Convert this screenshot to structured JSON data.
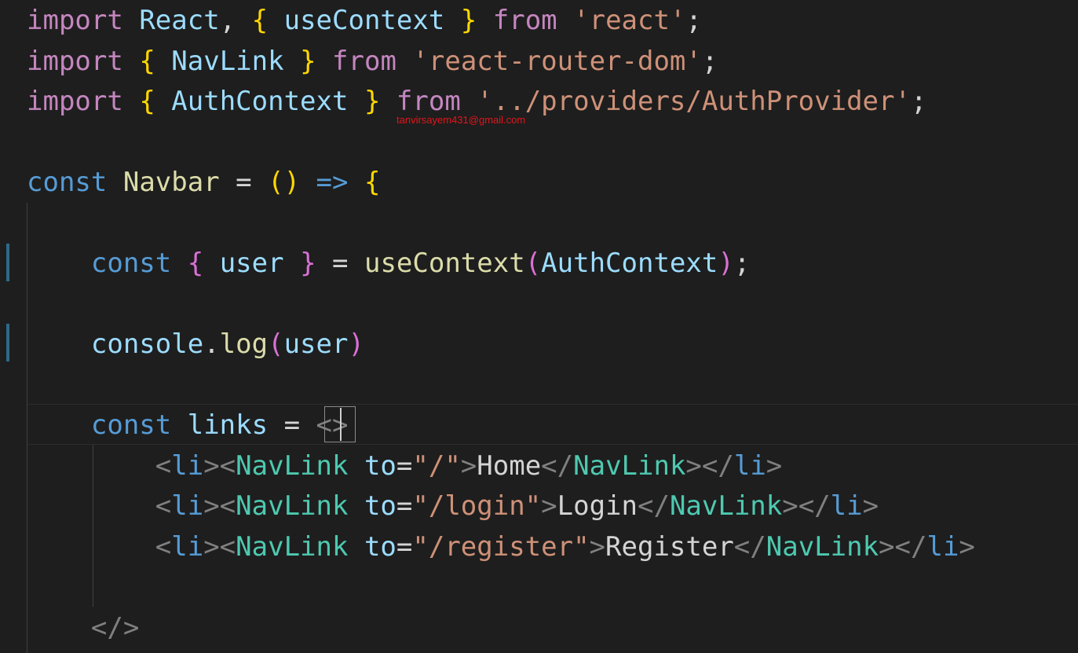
{
  "editor": {
    "language": "javascript-react",
    "theme": "dark",
    "colors": {
      "background": "#1e1e1e",
      "keyword_import": "#c586c0",
      "keyword_const": "#569cd6",
      "variable": "#9cdcfe",
      "function": "#dcdcaa",
      "string": "#ce9178",
      "bracket_level1": "#ffd700",
      "bracket_level2": "#da70d6",
      "bracket_level3": "#179fff",
      "component": "#4ec9b0",
      "angle_bracket": "#808080"
    }
  },
  "watermark": "tanvirsayem431@gmail.com",
  "lines": [
    [
      {
        "t": "import",
        "c": "t-kw"
      },
      {
        "t": " ",
        "c": "t-txt"
      },
      {
        "t": "React",
        "c": "t-var"
      },
      {
        "t": ", ",
        "c": "t-txt"
      },
      {
        "t": "{",
        "c": "t-br1"
      },
      {
        "t": " ",
        "c": "t-txt"
      },
      {
        "t": "useContext",
        "c": "t-var"
      },
      {
        "t": " ",
        "c": "t-txt"
      },
      {
        "t": "}",
        "c": "t-br1"
      },
      {
        "t": " ",
        "c": "t-txt"
      },
      {
        "t": "from",
        "c": "t-kw"
      },
      {
        "t": " ",
        "c": "t-txt"
      },
      {
        "t": "'react'",
        "c": "t-str"
      },
      {
        "t": ";",
        "c": "t-txt"
      }
    ],
    [
      {
        "t": "import",
        "c": "t-kw"
      },
      {
        "t": " ",
        "c": "t-txt"
      },
      {
        "t": "{",
        "c": "t-br1"
      },
      {
        "t": " ",
        "c": "t-txt"
      },
      {
        "t": "NavLink",
        "c": "t-var"
      },
      {
        "t": " ",
        "c": "t-txt"
      },
      {
        "t": "}",
        "c": "t-br1"
      },
      {
        "t": " ",
        "c": "t-txt"
      },
      {
        "t": "from",
        "c": "t-kw"
      },
      {
        "t": " ",
        "c": "t-txt"
      },
      {
        "t": "'react-router-dom'",
        "c": "t-str"
      },
      {
        "t": ";",
        "c": "t-txt"
      }
    ],
    [
      {
        "t": "import",
        "c": "t-kw"
      },
      {
        "t": " ",
        "c": "t-txt"
      },
      {
        "t": "{",
        "c": "t-br1"
      },
      {
        "t": " ",
        "c": "t-txt"
      },
      {
        "t": "AuthContext",
        "c": "t-var"
      },
      {
        "t": " ",
        "c": "t-txt"
      },
      {
        "t": "}",
        "c": "t-br1"
      },
      {
        "t": " ",
        "c": "t-txt"
      },
      {
        "t": "from",
        "c": "t-kw"
      },
      {
        "t": " ",
        "c": "t-txt"
      },
      {
        "t": "'../providers/AuthProvider'",
        "c": "t-str"
      },
      {
        "t": ";",
        "c": "t-txt"
      }
    ],
    [],
    [
      {
        "t": "const",
        "c": "t-kw2"
      },
      {
        "t": " ",
        "c": "t-txt"
      },
      {
        "t": "Navbar",
        "c": "t-fn"
      },
      {
        "t": " = ",
        "c": "t-txt"
      },
      {
        "t": "()",
        "c": "t-br1"
      },
      {
        "t": " ",
        "c": "t-txt"
      },
      {
        "t": "=>",
        "c": "t-kw2"
      },
      {
        "t": " ",
        "c": "t-txt"
      },
      {
        "t": "{",
        "c": "t-br1"
      }
    ],
    [],
    [
      {
        "t": "    ",
        "c": "t-txt"
      },
      {
        "t": "const",
        "c": "t-kw2"
      },
      {
        "t": " ",
        "c": "t-txt"
      },
      {
        "t": "{",
        "c": "t-br2"
      },
      {
        "t": " ",
        "c": "t-txt"
      },
      {
        "t": "user",
        "c": "t-var"
      },
      {
        "t": " ",
        "c": "t-txt"
      },
      {
        "t": "}",
        "c": "t-br2"
      },
      {
        "t": " = ",
        "c": "t-txt"
      },
      {
        "t": "useContext",
        "c": "t-fn"
      },
      {
        "t": "(",
        "c": "t-br2"
      },
      {
        "t": "AuthContext",
        "c": "t-var"
      },
      {
        "t": ")",
        "c": "t-br2"
      },
      {
        "t": ";",
        "c": "t-txt"
      }
    ],
    [],
    [
      {
        "t": "    ",
        "c": "t-txt"
      },
      {
        "t": "console",
        "c": "t-var"
      },
      {
        "t": ".",
        "c": "t-txt"
      },
      {
        "t": "log",
        "c": "t-fn"
      },
      {
        "t": "(",
        "c": "t-br2"
      },
      {
        "t": "user",
        "c": "t-var"
      },
      {
        "t": ")",
        "c": "t-br2"
      }
    ],
    [],
    [
      {
        "t": "    ",
        "c": "t-txt"
      },
      {
        "t": "const",
        "c": "t-kw2"
      },
      {
        "t": " ",
        "c": "t-txt"
      },
      {
        "t": "links",
        "c": "t-var"
      },
      {
        "t": " = ",
        "c": "t-txt"
      },
      {
        "t": "<>",
        "c": "t-ang"
      }
    ],
    [
      {
        "t": "        ",
        "c": "t-txt"
      },
      {
        "t": "<",
        "c": "t-ang"
      },
      {
        "t": "li",
        "c": "t-tag"
      },
      {
        "t": "><",
        "c": "t-ang"
      },
      {
        "t": "NavLink",
        "c": "t-comp"
      },
      {
        "t": " ",
        "c": "t-txt"
      },
      {
        "t": "to",
        "c": "t-attr"
      },
      {
        "t": "=",
        "c": "t-txt"
      },
      {
        "t": "\"/\"",
        "c": "t-str"
      },
      {
        "t": ">",
        "c": "t-ang"
      },
      {
        "t": "Home",
        "c": "t-txt"
      },
      {
        "t": "</",
        "c": "t-ang"
      },
      {
        "t": "NavLink",
        "c": "t-comp"
      },
      {
        "t": "></",
        "c": "t-ang"
      },
      {
        "t": "li",
        "c": "t-tag"
      },
      {
        "t": ">",
        "c": "t-ang"
      }
    ],
    [
      {
        "t": "        ",
        "c": "t-txt"
      },
      {
        "t": "<",
        "c": "t-ang"
      },
      {
        "t": "li",
        "c": "t-tag"
      },
      {
        "t": "><",
        "c": "t-ang"
      },
      {
        "t": "NavLink",
        "c": "t-comp"
      },
      {
        "t": " ",
        "c": "t-txt"
      },
      {
        "t": "to",
        "c": "t-attr"
      },
      {
        "t": "=",
        "c": "t-txt"
      },
      {
        "t": "\"/login\"",
        "c": "t-str"
      },
      {
        "t": ">",
        "c": "t-ang"
      },
      {
        "t": "Login",
        "c": "t-txt"
      },
      {
        "t": "</",
        "c": "t-ang"
      },
      {
        "t": "NavLink",
        "c": "t-comp"
      },
      {
        "t": "></",
        "c": "t-ang"
      },
      {
        "t": "li",
        "c": "t-tag"
      },
      {
        "t": ">",
        "c": "t-ang"
      }
    ],
    [
      {
        "t": "        ",
        "c": "t-txt"
      },
      {
        "t": "<",
        "c": "t-ang"
      },
      {
        "t": "li",
        "c": "t-tag"
      },
      {
        "t": "><",
        "c": "t-ang"
      },
      {
        "t": "NavLink",
        "c": "t-comp"
      },
      {
        "t": " ",
        "c": "t-txt"
      },
      {
        "t": "to",
        "c": "t-attr"
      },
      {
        "t": "=",
        "c": "t-txt"
      },
      {
        "t": "\"/register\"",
        "c": "t-str"
      },
      {
        "t": ">",
        "c": "t-ang"
      },
      {
        "t": "Register",
        "c": "t-txt"
      },
      {
        "t": "</",
        "c": "t-ang"
      },
      {
        "t": "NavLink",
        "c": "t-comp"
      },
      {
        "t": "></",
        "c": "t-ang"
      },
      {
        "t": "li",
        "c": "t-tag"
      },
      {
        "t": ">",
        "c": "t-ang"
      }
    ],
    [],
    [
      {
        "t": "    ",
        "c": "t-txt"
      },
      {
        "t": "</>",
        "c": "t-ang"
      }
    ]
  ]
}
